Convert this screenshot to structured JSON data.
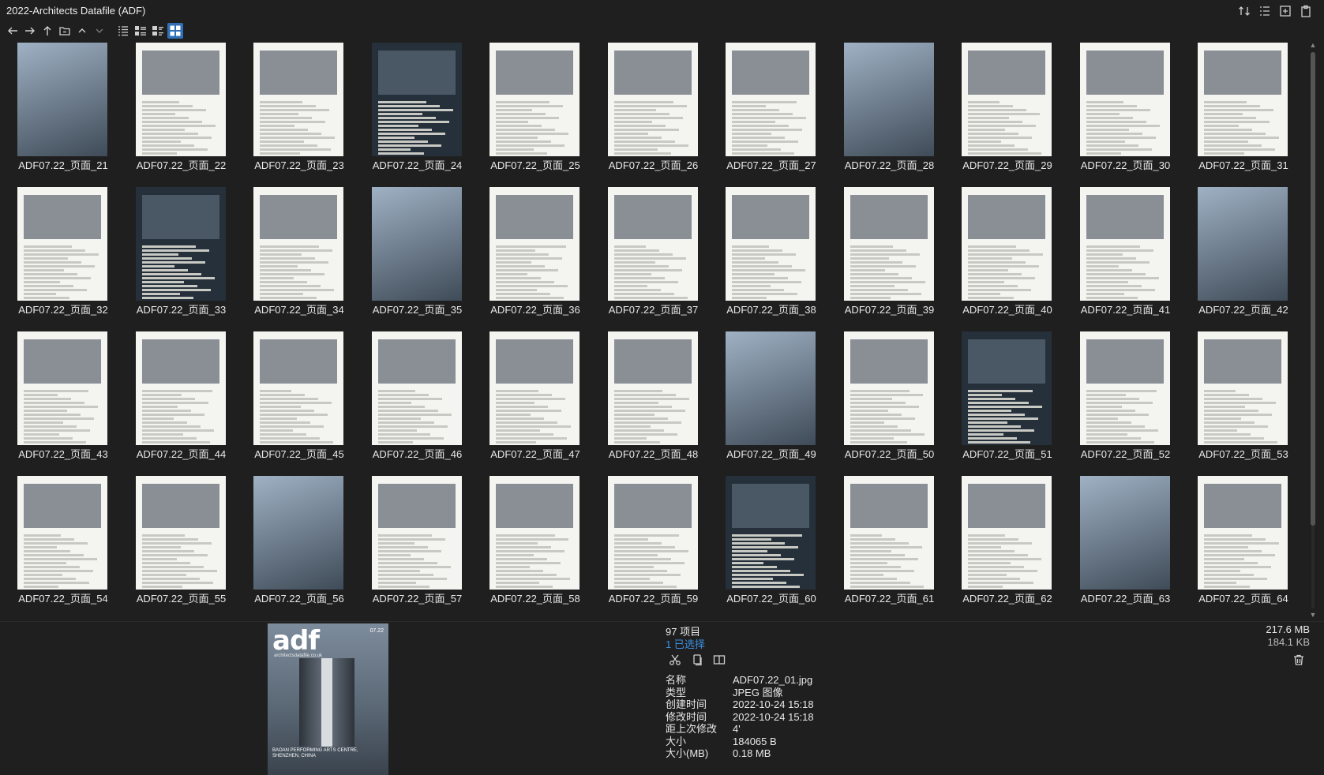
{
  "window": {
    "title": "2022-Architects Datafile (ADF)"
  },
  "topbar_icons": [
    "sort-icon",
    "details-list-icon",
    "new-tab-icon",
    "clipboard-icon"
  ],
  "toolbar": {
    "buttons": [
      "back-arrow-icon",
      "forward-arrow-icon",
      "up-arrow-icon",
      "folder-icon",
      "chevron-up-icon",
      "chevron-down-icon",
      "list-view-icon",
      "details-view-icon",
      "tiles-view-icon",
      "thumbnails-view-icon"
    ]
  },
  "files": [
    "ADF07.22_页面_21",
    "ADF07.22_页面_22",
    "ADF07.22_页面_23",
    "ADF07.22_页面_24",
    "ADF07.22_页面_25",
    "ADF07.22_页面_26",
    "ADF07.22_页面_27",
    "ADF07.22_页面_28",
    "ADF07.22_页面_29",
    "ADF07.22_页面_30",
    "ADF07.22_页面_31",
    "ADF07.22_页面_32",
    "ADF07.22_页面_33",
    "ADF07.22_页面_34",
    "ADF07.22_页面_35",
    "ADF07.22_页面_36",
    "ADF07.22_页面_37",
    "ADF07.22_页面_38",
    "ADF07.22_页面_39",
    "ADF07.22_页面_40",
    "ADF07.22_页面_41",
    "ADF07.22_页面_42",
    "ADF07.22_页面_43",
    "ADF07.22_页面_44",
    "ADF07.22_页面_45",
    "ADF07.22_页面_46",
    "ADF07.22_页面_47",
    "ADF07.22_页面_48",
    "ADF07.22_页面_49",
    "ADF07.22_页面_50",
    "ADF07.22_页面_51",
    "ADF07.22_页面_52",
    "ADF07.22_页面_53",
    "ADF07.22_页面_54",
    "ADF07.22_页面_55",
    "ADF07.22_页面_56",
    "ADF07.22_页面_57",
    "ADF07.22_页面_58",
    "ADF07.22_页面_59",
    "ADF07.22_页面_60",
    "ADF07.22_页面_61",
    "ADF07.22_页面_62",
    "ADF07.22_页面_63",
    "ADF07.22_页面_64"
  ],
  "preview": {
    "logo": "adf",
    "tagline": "architectsdatafile.co.uk",
    "issue": "07.22",
    "caption": "BAOAN PERFORMING ARTS CENTRE, SHENZHEN, CHINA"
  },
  "status": {
    "item_count": "97 项目",
    "selected": "1 已选择",
    "total_size": "217.6 MB",
    "selected_size": "184.1 KB"
  },
  "actions": [
    "scissors-icon",
    "copy-icon",
    "compare-icon"
  ],
  "properties": [
    {
      "key": "名称",
      "value": "ADF07.22_01.jpg"
    },
    {
      "key": "类型",
      "value": "JPEG 图像"
    },
    {
      "key": "创建时间",
      "value": "2022-10-24  15:18"
    },
    {
      "key": "修改时间",
      "value": "2022-10-24  15:18"
    },
    {
      "key": "距上次修改",
      "value": "4'"
    },
    {
      "key": "大小",
      "value": "184065 B"
    },
    {
      "key": "大小(MB)",
      "value": "0.18 MB"
    }
  ]
}
